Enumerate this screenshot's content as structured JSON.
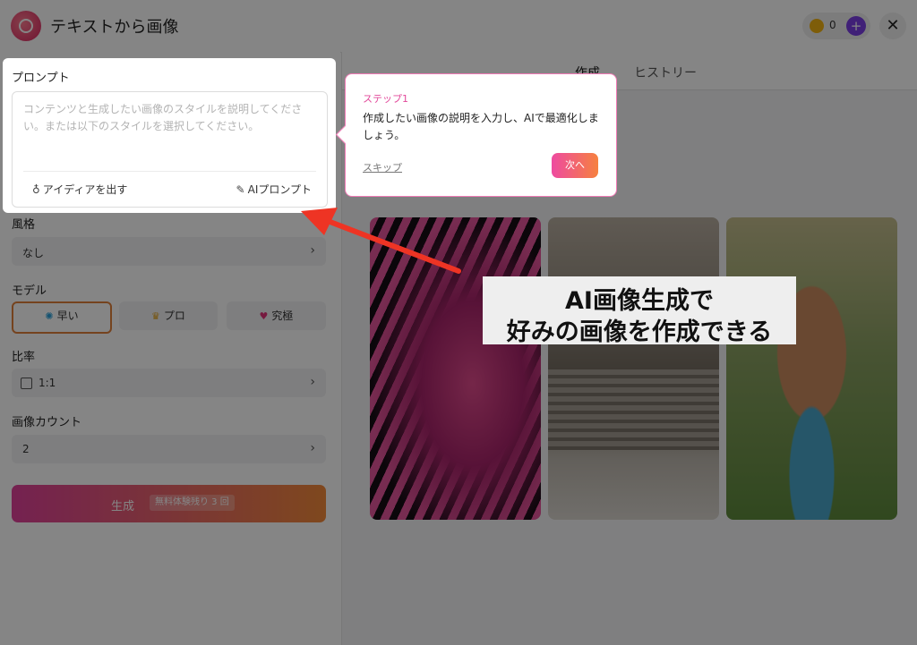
{
  "header": {
    "title": "テキストから画像",
    "credits": "0",
    "plus": "+",
    "close": "✕"
  },
  "tabs": [
    {
      "label": "作成"
    },
    {
      "label": "ヒストリー"
    }
  ],
  "prompt": {
    "title": "プロンプト",
    "placeholder": "コンテンツと生成したい画像のスタイルを説明してください。または以下のスタイルを選択してください。",
    "idea_button": "アイディアを出す",
    "ai_button": "AIプロンプト"
  },
  "style": {
    "label": "風格",
    "value": "なし"
  },
  "model": {
    "label": "モデル",
    "options": [
      {
        "label": "早い"
      },
      {
        "label": "プロ"
      },
      {
        "label": "究極"
      }
    ]
  },
  "ratio": {
    "label": "比率",
    "value": "1:1"
  },
  "count": {
    "label": "画像カウント",
    "value": "2"
  },
  "generate": {
    "label": "生成",
    "badge": "無料体験残り 3 回"
  },
  "tooltip": {
    "step": "ステップ1",
    "text": "作成したい画像の説明を入力し、AIで最適化しましょう。",
    "skip": "スキップ",
    "next": "次へ"
  },
  "annotation": {
    "line1": "AI画像生成で",
    "line2": "好みの画像を作成できる"
  },
  "colors": {
    "accent": "#e8457c",
    "gradient_start": "#e0409b",
    "gradient_end": "#f38a3a",
    "arrow": "#ee3424"
  }
}
